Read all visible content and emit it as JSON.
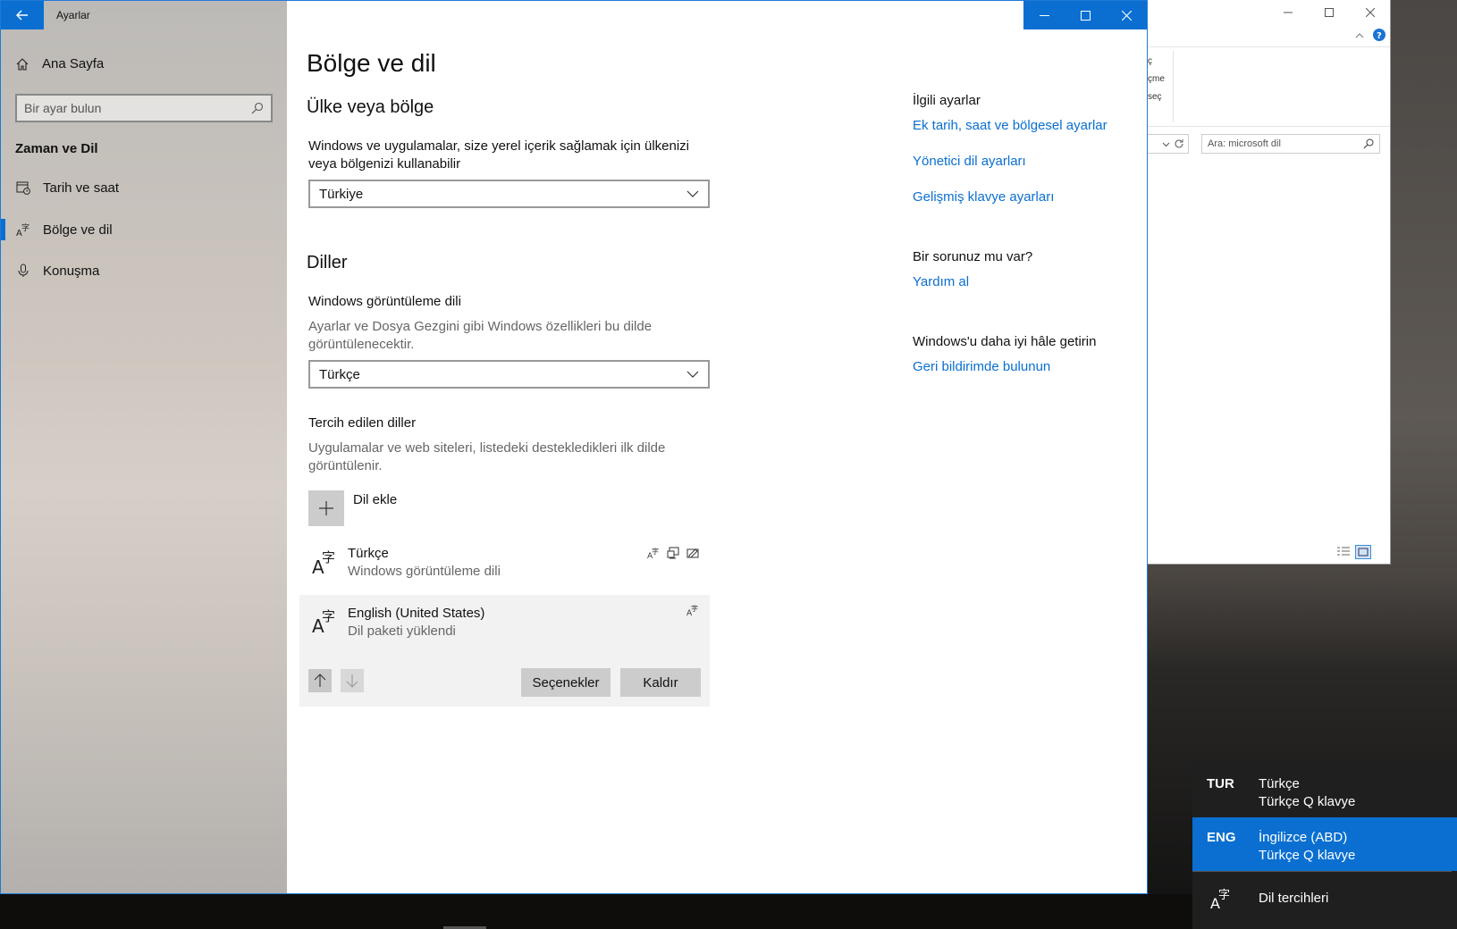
{
  "settings": {
    "app_title": "Ayarlar",
    "home_label": "Ana Sayfa",
    "search_placeholder": "Bir ayar bulun",
    "section_title": "Zaman ve Dil",
    "nav": [
      {
        "label": "Tarih ve saat",
        "icon": "calendar-clock-icon",
        "active": false
      },
      {
        "label": "Bölge ve dil",
        "icon": "language-icon",
        "active": true
      },
      {
        "label": "Konuşma",
        "icon": "microphone-icon",
        "active": false
      }
    ],
    "accent": "#0a6fd1"
  },
  "page": {
    "title": "Bölge ve dil",
    "country": {
      "heading": "Ülke veya bölge",
      "description": "Windows ve uygulamalar, size yerel içerik sağlamak için ülkenizi veya bölgenizi kullanabilir",
      "selected": "Türkiye"
    },
    "languages": {
      "heading": "Diller",
      "display_lang_label": "Windows görüntüleme dili",
      "display_lang_desc": "Ayarlar ve Dosya Gezgini gibi Windows özellikleri bu dilde görüntülenecektir.",
      "display_lang_selected": "Türkçe",
      "preferred_label": "Tercih edilen diller",
      "preferred_desc": "Uygulamalar ve web siteleri, listedeki destekledikleri ilk dilde görüntülenir.",
      "add_label": "Dil ekle",
      "list": [
        {
          "name": "Türkçe",
          "desc": "Windows görüntüleme dili",
          "features": [
            "language-pack-icon",
            "display-icon",
            "handwriting-icon"
          ]
        },
        {
          "name": "English (United States)",
          "desc": "Dil paketi yüklendi",
          "features": [
            "language-pack-icon"
          ]
        }
      ],
      "options_button": "Seçenekler",
      "remove_button": "Kaldır"
    }
  },
  "related": {
    "heading": "İlgili ayarlar",
    "links": [
      "Ek tarih, saat ve bölgesel ayarlar",
      "Yönetici dil ayarları",
      "Gelişmiş klavye ayarları"
    ],
    "question_heading": "Bir sorunuz mu var?",
    "help_link": "Yardım al",
    "improve_heading": "Windows'u daha iyi hâle getirin",
    "feedback_link": "Geri bildirimde bulunun"
  },
  "explorer": {
    "ribbon_fragments": [
      "ç",
      "çme",
      "seç"
    ],
    "search_placeholder": "Ara: microsoft dil"
  },
  "flyout": {
    "items": [
      {
        "code": "TUR",
        "name": "Türkçe",
        "keyboard": "Türkçe Q klavye",
        "selected": false
      },
      {
        "code": "ENG",
        "name": "İngilizce (ABD)",
        "keyboard": "Türkçe Q klavye",
        "selected": true
      }
    ],
    "preferences_label": "Dil tercihleri"
  }
}
